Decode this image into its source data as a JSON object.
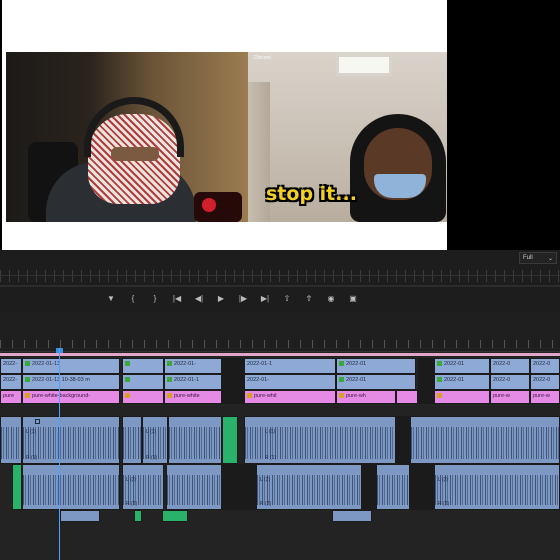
{
  "video": {
    "overlay_caption": "stop it...",
    "cam_tag": "Discord"
  },
  "monitor": {
    "playback_quality": "Full",
    "quality_chevron": "⌄"
  },
  "transport": {
    "buttons": [
      {
        "name": "add-marker",
        "glyph": "▼"
      },
      {
        "name": "mark-in",
        "glyph": "{"
      },
      {
        "name": "mark-out",
        "glyph": "}"
      },
      {
        "name": "go-to-in",
        "glyph": "|◀"
      },
      {
        "name": "step-back",
        "glyph": "◀|"
      },
      {
        "name": "play",
        "glyph": "▶"
      },
      {
        "name": "step-forward",
        "glyph": "|▶"
      },
      {
        "name": "go-to-out",
        "glyph": "▶|"
      },
      {
        "name": "lift",
        "glyph": "⇧"
      },
      {
        "name": "extract",
        "glyph": "⇮"
      },
      {
        "name": "export-frame",
        "glyph": "◉"
      },
      {
        "name": "comparison-view",
        "glyph": "▣"
      }
    ]
  },
  "timeline": {
    "v3_clips": [
      "2022-",
      "2022-01-13",
      "2022-01-",
      "2022-01-1",
      "2022-01",
      "2022-01",
      "2022-0",
      "2022-0"
    ],
    "v2_clips": [
      "2022-",
      "2022-01-13 10-38-03 m",
      "2022-01-",
      "2022-01-1",
      "2022-01",
      "2022-01",
      "2022-0",
      "2022-0"
    ],
    "v1_clips": [
      "pure",
      "pure-white-background-",
      "pure-white",
      "pure-whit",
      "pure-wh",
      "pure-w",
      "pure-w"
    ],
    "a1_top_labels": [
      "L (1)",
      "L (1)",
      "L (1)"
    ],
    "a1_bottom_labels": [
      "R (1)",
      "R (1)",
      "R (1)"
    ],
    "a2_top_labels": [
      "L (2)",
      "L (2)",
      "L (2)"
    ],
    "a2_bottom_labels": [
      "R (2)",
      "R (2)",
      "R (2)"
    ]
  },
  "colors": {
    "video_clip": "#8ea9d6",
    "graphic_clip": "#e58be6",
    "audio_clip": "#7e98c4",
    "green_clip": "#29b36a",
    "playhead": "#4ba3ff"
  }
}
